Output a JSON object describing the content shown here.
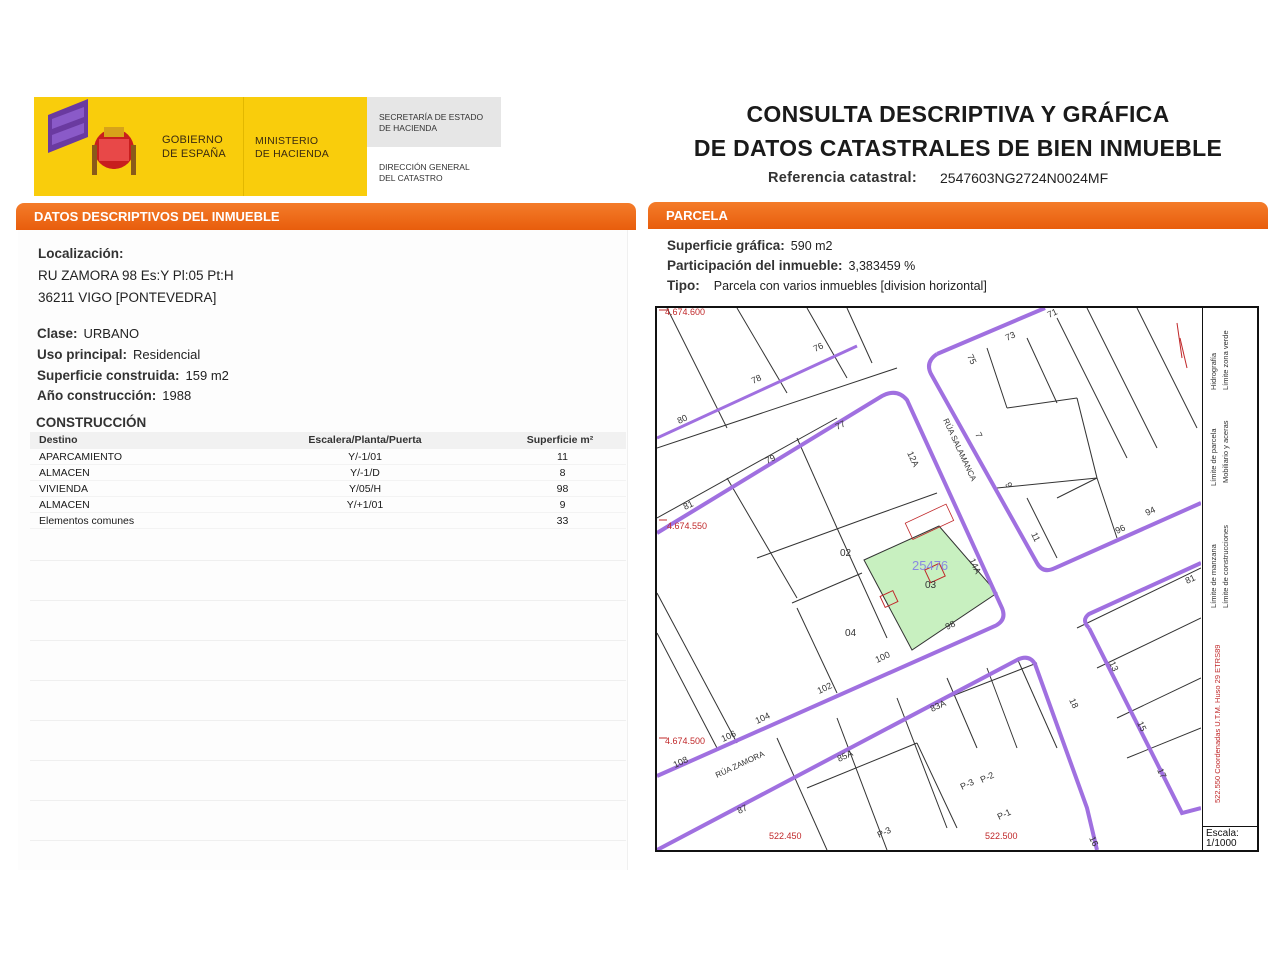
{
  "header": {
    "gov_line1": "GOBIERNO",
    "gov_line2": "DE ESPAÑA",
    "ministry_line1": "MINISTERIO",
    "ministry_line2": "DE HACIENDA",
    "secretary_line1": "SECRETARÍA DE ESTADO",
    "secretary_line2": "DE HACIENDA",
    "dg_line1": "DIRECCIÓN GENERAL",
    "dg_line2": "DEL CATASTRO",
    "title_line1": "CONSULTA DESCRIPTIVA Y GRÁFICA",
    "title_line2": "DE DATOS CATASTRALES DE BIEN INMUEBLE",
    "ref_label": "Referencia catastral:",
    "ref_value": "2547603NG2724N0024MF"
  },
  "left": {
    "bar_title": "DATOS DESCRIPTIVOS DEL INMUEBLE",
    "loc_label": "Localización:",
    "addr1": "RU ZAMORA 98 Es:Y Pl:05 Pt:H",
    "addr2": "36211 VIGO [PONTEVEDRA]",
    "clase_label": "Clase:",
    "clase_value": "URBANO",
    "uso_label": "Uso principal:",
    "uso_value": "Residencial",
    "sup_label": "Superficie construida:",
    "sup_value": "159 m2",
    "anio_label": "Año construcción:",
    "anio_value": "1988",
    "construccion_title": "CONSTRUCCIÓN",
    "table_headers": [
      "Destino",
      "Escalera/Planta/Puerta",
      "Superficie m²"
    ],
    "table_rows": [
      [
        "APARCAMIENTO",
        "Y/-1/01",
        "11"
      ],
      [
        "ALMACEN",
        "Y/-1/D",
        "8"
      ],
      [
        "VIVIENDA",
        "Y/05/H",
        "98"
      ],
      [
        "ALMACEN",
        "Y/+1/01",
        "9"
      ],
      [
        "Elementos comunes",
        "",
        "33"
      ]
    ]
  },
  "right": {
    "bar_title": "PARCELA",
    "sup_graf_label": "Superficie gráfica:",
    "sup_graf_value": "590 m2",
    "part_label": "Participación del inmueble:",
    "part_value": "3,383459 %",
    "tipo_label": "Tipo:",
    "tipo_value": "Parcela con varios inmuebles [division horizontal]"
  },
  "map": {
    "coord_top": "4.674.600",
    "coord_mid": "4.674.550",
    "coord_low": "4.674.500",
    "coord_x1": "522.450",
    "coord_x2": "522.500",
    "parcel_id": "25476",
    "street_1": "RÚA SALAMANCA",
    "street_2": "RÚA ZAMORA",
    "labels": [
      "76",
      "78",
      "80",
      "77",
      "79",
      "81",
      "12A",
      "75",
      "73",
      "71",
      "7",
      "9",
      "11",
      "96",
      "94",
      "81",
      "13",
      "15",
      "17",
      "18",
      "16",
      "14A",
      "98",
      "100",
      "102",
      "104",
      "106",
      "108",
      "02",
      "03",
      "04",
      "83A",
      "85A",
      "87",
      "P-3",
      "P-2",
      "P-1",
      "P-3",
      "18"
    ],
    "legend": [
      "Límite de manzana",
      "Límite de parcela",
      "Límite de construcciones",
      "Mobiliario y aceras",
      "Límite zona verde",
      "Hidrografía"
    ],
    "legend_coords": "522.550 Coordenadas U.T.M. Huso 29 ETRS89",
    "scale_label": "Escala:",
    "scale_value": "1/1000"
  },
  "colors": {
    "orange": "#f06a1a",
    "yellow": "#f9cd0c",
    "purple": "#a070e0",
    "parcel_green": "#c8f0c0"
  }
}
